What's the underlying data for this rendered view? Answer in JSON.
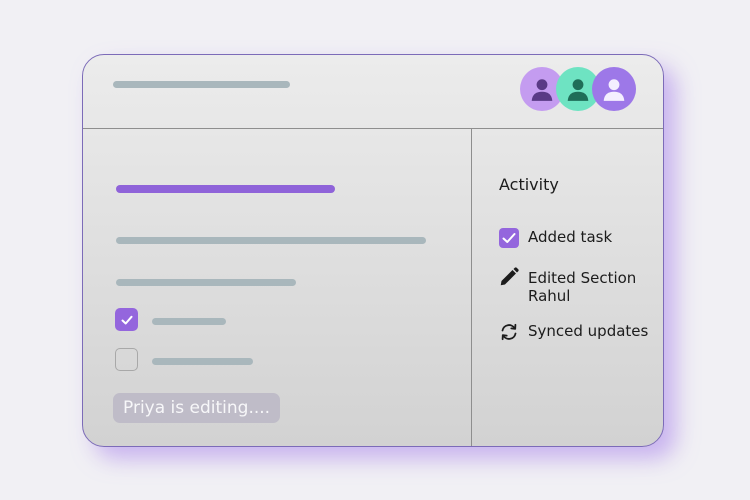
{
  "colors": {
    "accent": "#9466dd",
    "placeholder_bar": "#a9b7bc",
    "avatar_1": "#c49cf0",
    "avatar_2": "#6ee3c2",
    "avatar_3": "#9d78e8"
  },
  "header": {
    "avatars": [
      {
        "icon": "user-icon",
        "color": "#c49cf0"
      },
      {
        "icon": "user-icon",
        "color": "#6ee3c2"
      },
      {
        "icon": "user-icon",
        "color": "#9d78e8"
      }
    ]
  },
  "main": {
    "tasks": [
      {
        "checked": true
      },
      {
        "checked": false
      }
    ],
    "presence_label": "Priya is editing...."
  },
  "activity": {
    "title": "Activity",
    "items": [
      {
        "icon": "checkbox-checked-icon",
        "line1": "Added task",
        "line2": ""
      },
      {
        "icon": "pencil-icon",
        "line1": "Edited Section",
        "line2": "Rahul"
      },
      {
        "icon": "sync-icon",
        "line1": "Synced updates",
        "line2": ""
      }
    ]
  }
}
